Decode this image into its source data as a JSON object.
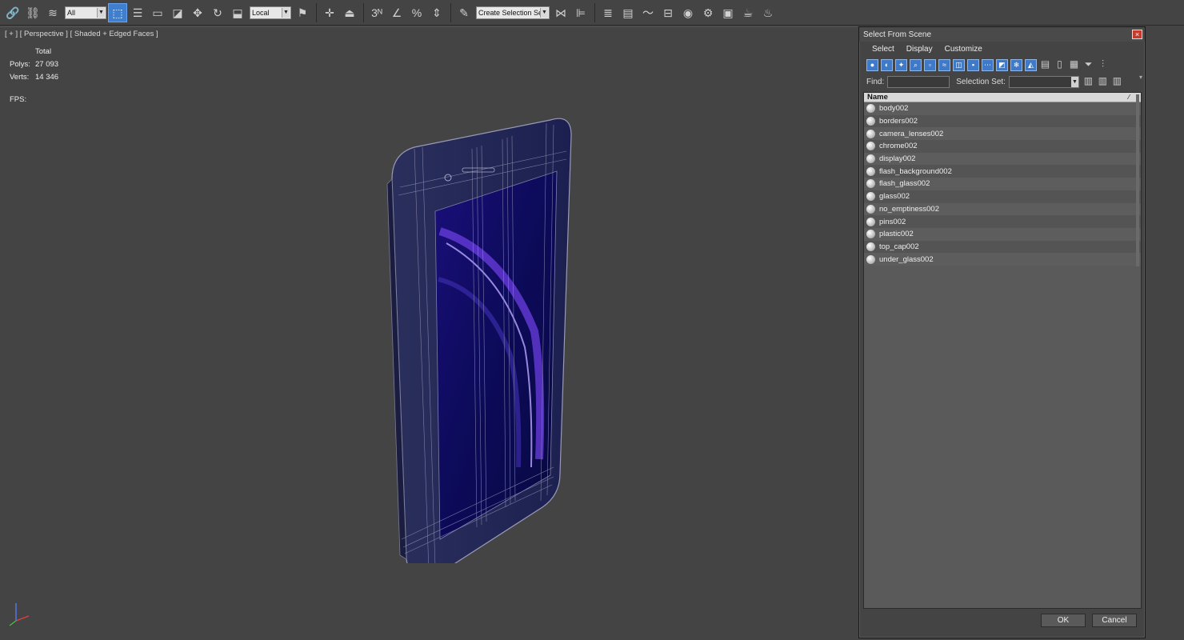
{
  "toolbar": {
    "filter_value": "All",
    "coordinate_value": "Local",
    "selection_set_placeholder": "Create Selection Se",
    "snap_label": "3",
    "percent_label": "%"
  },
  "viewport": {
    "label": "[ + ] [ Perspective ] [ Shaded + Edged Faces ]",
    "stats": {
      "header": "Total",
      "polys_label": "Polys:",
      "polys_value": "27 093",
      "verts_label": "Verts:",
      "verts_value": "14 346",
      "fps_label": "FPS:"
    }
  },
  "dialog": {
    "title": "Select From Scene",
    "close_symbol": "×",
    "menu": [
      "Select",
      "Display",
      "Customize"
    ],
    "find_label": "Find:",
    "find_value": "",
    "selection_set_label": "Selection Set:",
    "selection_set_value": "",
    "column_header": "Name",
    "objects": [
      "body002",
      "borders002",
      "camera_lenses002",
      "chrome002",
      "display002",
      "flash_background002",
      "flash_glass002",
      "glass002",
      "no_emptiness002",
      "pins002",
      "plastic002",
      "top_cap002",
      "under_glass002"
    ],
    "ok_label": "OK",
    "cancel_label": "Cancel"
  },
  "colors": {
    "ui_background": "#444444",
    "accent_blue": "#3f7fcf",
    "stats_yellow": "#e6d000",
    "screen_navy": "#0d0b5c",
    "screen_violet": "#6b3de0"
  }
}
